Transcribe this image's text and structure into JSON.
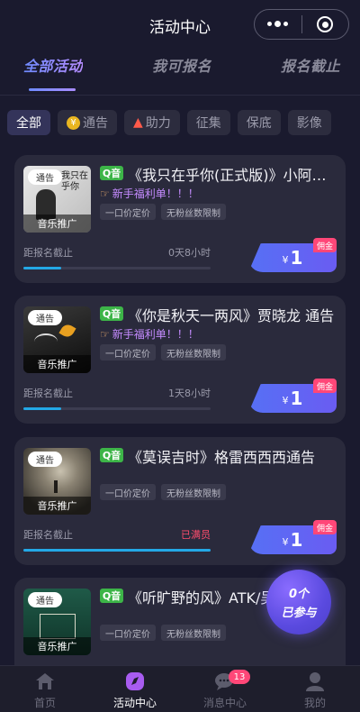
{
  "header": {
    "title": "活动中心"
  },
  "tabs": [
    {
      "label": "全部活动",
      "active": true
    },
    {
      "label": "我可报名",
      "active": false
    },
    {
      "label": "报名截止",
      "active": false
    }
  ],
  "filters": [
    {
      "label": "全部",
      "icon": "",
      "active": true
    },
    {
      "label": "通告",
      "icon": "coin-icon",
      "active": false
    },
    {
      "label": "助力",
      "icon": "flame-icon",
      "active": false
    },
    {
      "label": "征集",
      "icon": "",
      "active": false
    },
    {
      "label": "保底",
      "icon": "",
      "active": false
    },
    {
      "label": "影像",
      "icon": "",
      "active": false
    }
  ],
  "cards": [
    {
      "badge": "通告",
      "thumb_label": "音乐推广",
      "thumb_text": "我只在乎你",
      "platform": "Q音",
      "title": "《我只在乎你(正式版)》小阿七 通告",
      "welfare": "新手福利单！！！",
      "tags": [
        "一口价定价",
        "无粉丝数限制"
      ],
      "deadline_label": "距报名截止",
      "deadline_value": "0天8小时",
      "progress": 0.2,
      "price_currency": "¥",
      "price": "1",
      "commission": "佣金"
    },
    {
      "badge": "通告",
      "thumb_label": "音乐推广",
      "thumb_text": "",
      "platform": "Q音",
      "title": "《你是秋天一两风》贾晓龙 通告",
      "welfare": "新手福利单！！！",
      "tags": [
        "一口价定价",
        "无粉丝数限制"
      ],
      "deadline_label": "距报名截止",
      "deadline_value": "1天8小时",
      "progress": 0.2,
      "price_currency": "¥",
      "price": "1",
      "commission": "佣金"
    },
    {
      "badge": "通告",
      "thumb_label": "音乐推广",
      "thumb_text": "",
      "platform": "Q音",
      "title": "《莫误吉时》格雷西西西通告",
      "welfare": "",
      "tags": [
        "一口价定价",
        "无粉丝数限制"
      ],
      "deadline_label": "距报名截止",
      "deadline_value": "已满员",
      "progress": 1.0,
      "price_currency": "¥",
      "price": "1",
      "commission": "佣金"
    },
    {
      "badge": "通告",
      "thumb_label": "音乐推广",
      "thumb_text": "",
      "platform": "Q音",
      "title": "《听旷野的风》ATK/吴",
      "welfare": "",
      "tags": [
        "一口价定价",
        "无粉丝数限制"
      ]
    }
  ],
  "floating": {
    "count": "0个",
    "label": "已参与"
  },
  "bottom_nav": [
    {
      "label": "首页",
      "icon": "home-icon",
      "active": false
    },
    {
      "label": "活动中心",
      "icon": "activity-icon",
      "active": true
    },
    {
      "label": "消息中心",
      "icon": "message-icon",
      "active": false,
      "badge": "13"
    },
    {
      "label": "我的",
      "icon": "user-icon",
      "active": false
    }
  ],
  "colors": {
    "background": "#1a1a2e",
    "accent": "#6a5cf2",
    "commission": "#ff4778",
    "progress": "#23a8e6"
  }
}
